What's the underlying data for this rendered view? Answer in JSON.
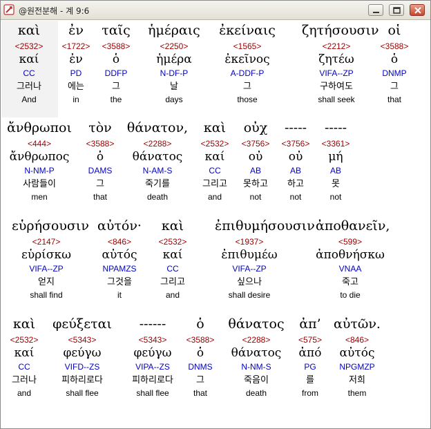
{
  "window": {
    "title": "@원전분해 - 계 9:6"
  },
  "icons": {
    "app": "app-icon",
    "minimize": "minimize-icon",
    "maximize": "maximize-icon",
    "close": "close-icon"
  },
  "colors": {
    "strong": "#a00000",
    "morph": "#0000c8",
    "text": "#000000",
    "highlight": "#f2f2f2"
  },
  "rows": [
    {
      "words": [
        {
          "greek": "καὶ",
          "strong": "<2532>",
          "lemma": "καί",
          "morph": "CC",
          "korean": "그러나",
          "english": "And"
        },
        {
          "greek": "ἐν",
          "strong": "<1722>",
          "lemma": "ἐν",
          "morph": "PD",
          "korean": "에는",
          "english": "in"
        },
        {
          "greek": "ταῖς",
          "strong": "<3588>",
          "lemma": "ὁ",
          "morph": "DDFP",
          "korean": "그",
          "english": "the"
        },
        {
          "greek": "ἡμέραις",
          "strong": "<2250>",
          "lemma": "ἡμέρα",
          "morph": "N-DF-P",
          "korean": "날",
          "english": "days"
        },
        {
          "greek": "ἐκείναις",
          "strong": "<1565>",
          "lemma": "ἐκεῖνος",
          "morph": "A-DDF-P",
          "korean": "그",
          "english": "those"
        },
        {
          "greek": "ζητήσουσιν",
          "strong": "<2212>",
          "lemma": "ζητέω",
          "morph": "VIFA--ZP",
          "korean": "구하여도",
          "english": "shall seek"
        },
        {
          "greek": "οἱ",
          "strong": "<3588>",
          "lemma": "ὁ",
          "morph": "DNMP",
          "korean": "그",
          "english": "that"
        }
      ]
    },
    {
      "words": [
        {
          "greek": "ἄνθρωποι",
          "strong": "<444>",
          "lemma": "ἄνθρωπος",
          "morph": "N-NM-P",
          "korean": "사람들이",
          "english": "men"
        },
        {
          "greek": "τὸν",
          "strong": "<3588>",
          "lemma": "ὁ",
          "morph": "DAMS",
          "korean": "그",
          "english": "that"
        },
        {
          "greek": "θάνατον,",
          "strong": "<2288>",
          "lemma": "θάνατος",
          "morph": "N-AM-S",
          "korean": "죽기를",
          "english": "death"
        },
        {
          "greek": "καὶ",
          "strong": "<2532>",
          "lemma": "καί",
          "morph": "CC",
          "korean": "그리고",
          "english": "and"
        },
        {
          "greek": "οὐχ",
          "strong": "<3756>",
          "lemma": "οὐ",
          "morph": "AB",
          "korean": "못하고",
          "english": "not"
        },
        {
          "greek": "-----",
          "strong": "<3756>",
          "lemma": "οὐ",
          "morph": "AB",
          "korean": "하고",
          "english": "not"
        },
        {
          "greek": "-----",
          "strong": "<3361>",
          "lemma": "μή",
          "morph": "AB",
          "korean": "못",
          "english": "not"
        }
      ]
    },
    {
      "words": [
        {
          "greek": "εὑρήσουσιν",
          "strong": "<2147>",
          "lemma": "εὑρίσκω",
          "morph": "VIFA--ZP",
          "korean": "얻지",
          "english": "shall find"
        },
        {
          "greek": "αὐτόν·",
          "strong": "<846>",
          "lemma": "αὐτός",
          "morph": "NPAMZS",
          "korean": "그것을",
          "english": "it"
        },
        {
          "greek": "καὶ",
          "strong": "<2532>",
          "lemma": "καί",
          "morph": "CC",
          "korean": "그리고",
          "english": "and"
        },
        {
          "greek": "ἐπιθυμήσουσιν",
          "strong": "<1937>",
          "lemma": "ἐπιθυμέω",
          "morph": "VIFA--ZP",
          "korean": "싶으나",
          "english": "shall desire"
        },
        {
          "greek": "ἀποθανεῖν,",
          "strong": "<599>",
          "lemma": "ἀποθνήσκω",
          "morph": "VNAA",
          "korean": "죽고",
          "english": "to die"
        }
      ]
    },
    {
      "words": [
        {
          "greek": "καὶ",
          "strong": "<2532>",
          "lemma": "καί",
          "morph": "CC",
          "korean": "그러나",
          "english": "and"
        },
        {
          "greek": "φεύξεται",
          "strong": "<5343>",
          "lemma": "φεύγω",
          "morph": "VIFD--ZS",
          "korean": "피하리로다",
          "english": "shall flee"
        },
        {
          "greek": "------",
          "strong": "<5343>",
          "lemma": "φεύγω",
          "morph": "VIPA--ZS",
          "korean": "피하리로다",
          "english": "shall flee"
        },
        {
          "greek": "ὁ",
          "strong": "<3588>",
          "lemma": "ὁ",
          "morph": "DNMS",
          "korean": "그",
          "english": "that"
        },
        {
          "greek": "θάνατος",
          "strong": "<2288>",
          "lemma": "θάνατος",
          "morph": "N-NM-S",
          "korean": "죽음이",
          "english": "death"
        },
        {
          "greek": "ἀπ’",
          "strong": "<575>",
          "lemma": "ἀπό",
          "morph": "PG",
          "korean": "를",
          "english": "from"
        },
        {
          "greek": "αὐτῶν.",
          "strong": "<846>",
          "lemma": "αὐτός",
          "morph": "NPGMZP",
          "korean": "저희",
          "english": "them"
        }
      ]
    }
  ]
}
